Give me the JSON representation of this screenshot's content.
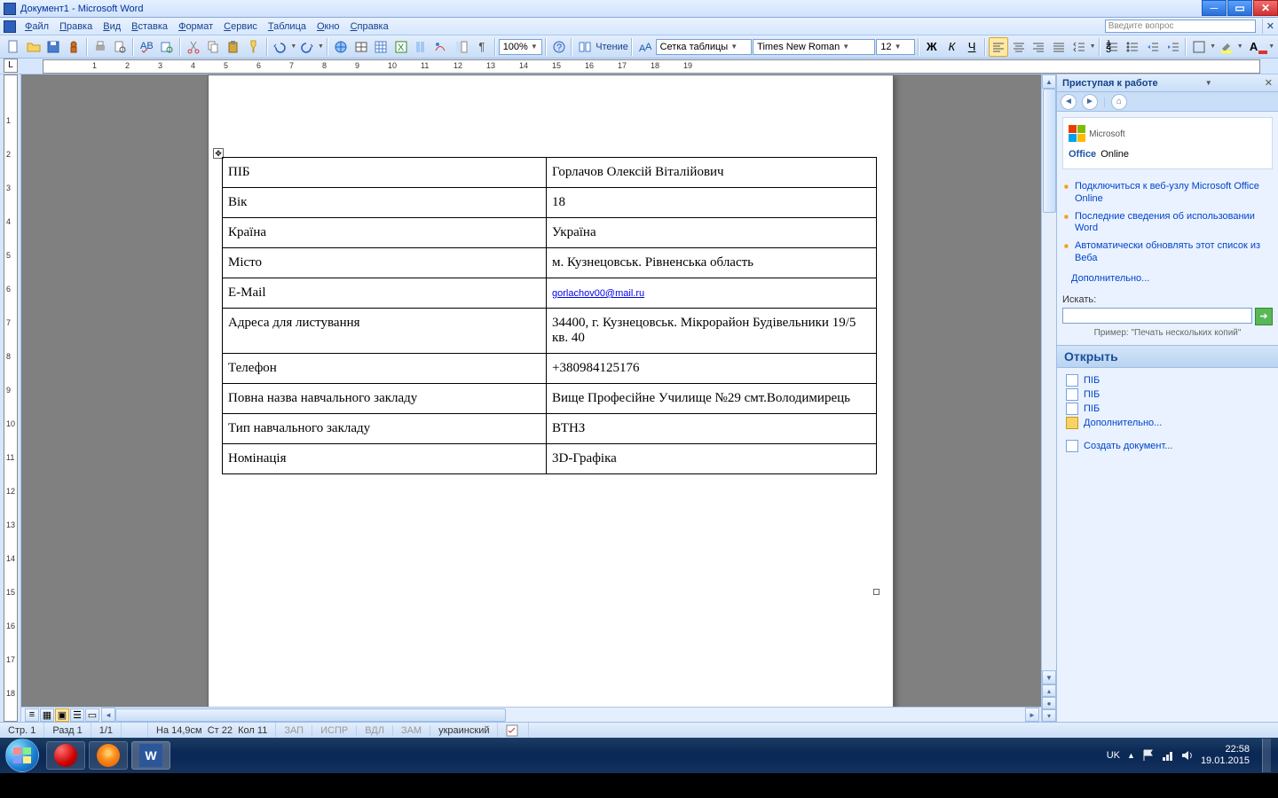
{
  "window": {
    "title": "Документ1 - Microsoft Word"
  },
  "menus": [
    "Файл",
    "Правка",
    "Вид",
    "Вставка",
    "Формат",
    "Сервис",
    "Таблица",
    "Окно",
    "Справка"
  ],
  "question_placeholder": "Введите вопрос",
  "toolbar": {
    "zoom": "100%",
    "read": "Чтение",
    "table_style": "Сетка таблицы",
    "font": "Times New Roman",
    "size": "12"
  },
  "doc_rows": [
    {
      "label": "ПІБ",
      "value": "Горлачов Олексій Віталійович"
    },
    {
      "label": "Вік",
      "value": "18"
    },
    {
      "label": "Країна",
      "value": "Україна"
    },
    {
      "label": "Місто",
      "value": "м. Кузнецовськ. Рівненська область"
    },
    {
      "label": "E-Mail",
      "value": "gorlachov00@mail.ru",
      "link": true
    },
    {
      "label": "Адреса для листування",
      "value": "34400, г. Кузнецовськ. Мікрорайон Будівельники 19/5 кв. 40"
    },
    {
      "label": "Телефон",
      "value": "+380984125176"
    },
    {
      "label": "Повна назва навчального закладу",
      "value": "Вище Професійне Училище №29 смт.Володимирець"
    },
    {
      "label": "Тип навчального закладу",
      "value": "ВТНЗ"
    },
    {
      "label": "Номінація",
      "value": "3D-Графіка"
    }
  ],
  "taskpane": {
    "title": "Приступая к работе",
    "office": "Office",
    "online": "Online",
    "ms": "Microsoft",
    "links": [
      "Подключиться к веб-узлу Microsoft Office Online",
      "Последние сведения об использовании Word",
      "Автоматически обновлять этот список из Веба"
    ],
    "more": "Дополнительно...",
    "search_label": "Искать:",
    "example": "Пример:  \"Печать нескольких копий\"",
    "open": "Открыть",
    "recent": [
      "ПІБ",
      "ПІБ",
      "ПІБ"
    ],
    "more_files": "Дополнительно...",
    "new_doc": "Создать документ..."
  },
  "status": {
    "page": "Стр. 1",
    "section": "Разд 1",
    "pages": "1/1",
    "pos": "На 14,9см",
    "st": "Ст 22",
    "col": "Кол 11",
    "dim": [
      "ЗАП",
      "ИСПР",
      "ВДЛ",
      "ЗАМ"
    ],
    "lang": "украинский"
  },
  "tray": {
    "lang": "UK",
    "time": "22:58",
    "date": "19.01.2015"
  }
}
